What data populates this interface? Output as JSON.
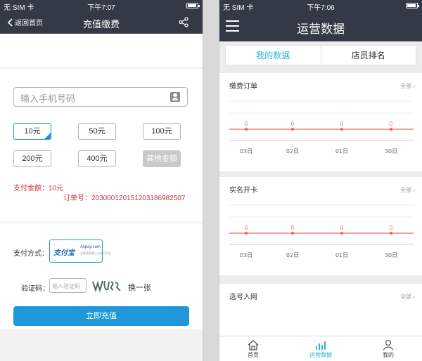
{
  "left": {
    "status": {
      "carrier": "无 SIM 卡",
      "time": "下午7:07"
    },
    "nav": {
      "back_label": "返回首页",
      "title": "充值缴费"
    },
    "form": {
      "phone_placeholder": "输入手机号码",
      "amounts": [
        "10元",
        "50元",
        "100元",
        "200元",
        "400元",
        "其他金额"
      ],
      "selected_amount": "10元",
      "pay_amount": "支付金额：10元",
      "order_no": "订单号：20300012015120318698250​7",
      "pay_method_label": "支付方式：",
      "alipay_name": "支付宝",
      "alipay_en": "Alipay.com",
      "alipay_sub": "全球领先第三方支付平台",
      "captcha_label": "验证码：",
      "captcha_placeholder": "输入验证码",
      "captcha_refresh": "换一张",
      "submit_label": "立即充值"
    }
  },
  "right": {
    "status": {
      "carrier": "无 SIM 卡",
      "time": "下午7:06"
    },
    "nav": {
      "title": "运营数据"
    },
    "tabs": [
      {
        "label": "我的数据",
        "active": true
      },
      {
        "label": "店员排名",
        "active": false
      }
    ],
    "cards": [
      {
        "title": "缴费订单",
        "more": "全部",
        "chart_data": {
          "type": "line",
          "categories": [
            "03日",
            "02日",
            "01日",
            "30日"
          ],
          "series": [
            {
              "values": [
                0,
                0,
                0,
                0
              ]
            }
          ],
          "color": "#ee6a50"
        }
      },
      {
        "title": "实名开卡",
        "more": "全部",
        "chart_data": {
          "type": "line",
          "categories": [
            "03日",
            "02日",
            "01日",
            "30日"
          ],
          "series": [
            {
              "values": [
                0,
                0,
                0,
                0
              ]
            }
          ],
          "color": "#ee6a50"
        }
      },
      {
        "title": "选号入网",
        "more": "全部"
      }
    ],
    "tabbar": [
      {
        "label": "首页",
        "icon": "home-icon",
        "active": false
      },
      {
        "label": "运营数据",
        "icon": "bar-chart-icon",
        "active": true
      },
      {
        "label": "我的",
        "icon": "user-icon",
        "active": false
      }
    ]
  }
}
